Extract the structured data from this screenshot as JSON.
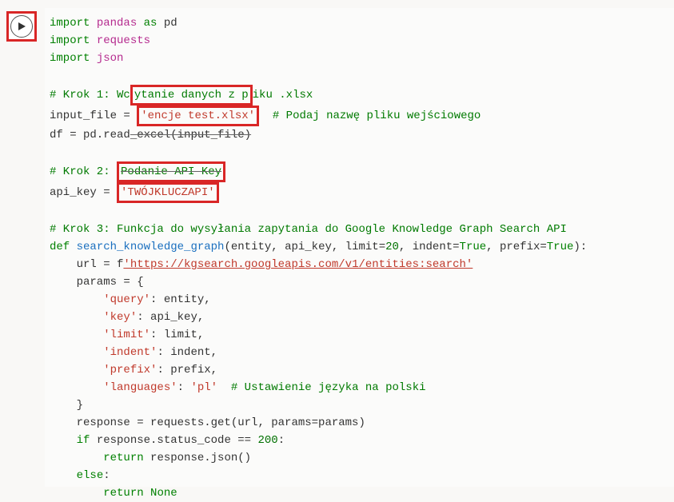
{
  "cell": {
    "run_tooltip": "Run cell"
  },
  "code": {
    "l1_import": "import",
    "l1_mod": "pandas",
    "l1_as": "as",
    "l1_alias": "pd",
    "l2_import": "import",
    "l2_mod": "requests",
    "l3_import": "import",
    "l3_mod": "json",
    "c1": "# Krok 1: Wc",
    "c1b": "ytanie danych z p",
    "c1c": "iku .xlsx",
    "l5a": "input_file =",
    "l5_str": "'encje test.xlsx'",
    "l5_cmt": "# Podaj nazwę pliku wejściowego",
    "l6a": "df = pd.read",
    "l6b": "_excel(input_file)",
    "c2a": "# Krok 2: ",
    "c2b": "Podanie API Key",
    "l8a": "api_key = ",
    "l8_str": "'TWÓJKLUCZAPI'",
    "c3": "# Krok 3: Funkcja do wysyłania zapytania do Google Knowledge Graph Search API",
    "l10_def": "def",
    "l10_fn": "search_knowledge_graph",
    "l10_params": "(entity, api_key, limit=",
    "l10_num20": "20",
    "l10_params2": ", indent=",
    "l10_true1": "True",
    "l10_params3": ", prefix=",
    "l10_true2": "True",
    "l10_params4": "):",
    "l11a": "    url = f",
    "l11_url": "'https://kgsearch.googleapis.com/v1/entities:search'",
    "l12": "    params = {",
    "l13k": "'query'",
    "l13v": ": entity,",
    "l14k": "'key'",
    "l14v": ": api_key,",
    "l15k": "'limit'",
    "l15v": ": limit,",
    "l16k": "'indent'",
    "l16v": ": indent,",
    "l17k": "'prefix'",
    "l17v": ": prefix,",
    "l18k": "'languages'",
    "l18v": ": ",
    "l18s": "'pl'",
    "l18c": "  # Ustawienie języka na polski",
    "l19": "    }",
    "l20": "    response = requests.get(url, params=params)",
    "l21_if": "if",
    "l21_rest": " response.status_code == ",
    "l21_200": "200",
    "l21_colon": ":",
    "l22_return": "return",
    "l22_rest": " response.json()",
    "l23_else": "else",
    "l23_colon": ":",
    "l24_return": "return",
    "l24_none": "None"
  }
}
